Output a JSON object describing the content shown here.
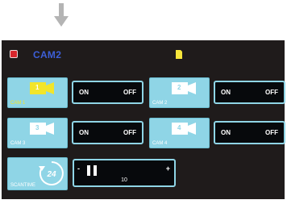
{
  "header": {
    "title": "CAM2",
    "left_icon": "camera-mode-icon",
    "right_icon": "sd-card-icon"
  },
  "cameras": [
    {
      "number": "1",
      "label": "CAM 1",
      "active": true
    },
    {
      "number": "2",
      "label": "CAM 2",
      "active": false
    },
    {
      "number": "3",
      "label": "CAM 3",
      "active": false
    },
    {
      "number": "4",
      "label": "CAM 4",
      "active": false
    }
  ],
  "toggles": [
    {
      "on_label": "ON",
      "off_label": "OFF"
    },
    {
      "on_label": "ON",
      "off_label": "OFF"
    },
    {
      "on_label": "ON",
      "off_label": "OFF"
    },
    {
      "on_label": "ON",
      "off_label": "OFF"
    }
  ],
  "scan": {
    "label": "SCANTIME",
    "icon_text": "24",
    "minus_label": "-",
    "plus_label": "+",
    "value": "10",
    "bars_filled": 2
  },
  "colors": {
    "panel_bg": "#1f1b1b",
    "tile_bg": "#8fd5e6",
    "active_accent": "#f2e52a",
    "title_blue": "#3d5fd8",
    "toggle_bg": "#07090c"
  }
}
